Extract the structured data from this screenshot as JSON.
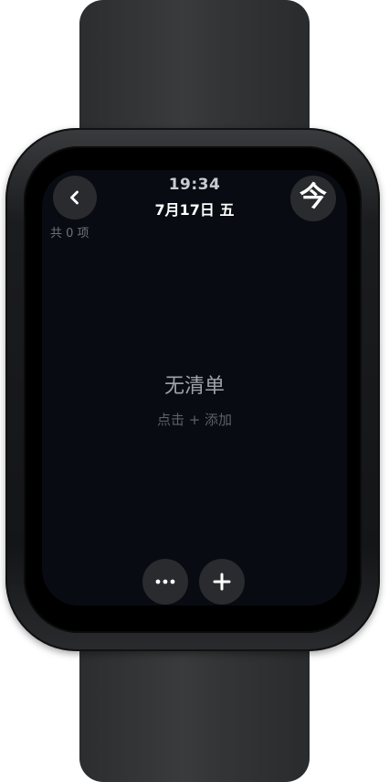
{
  "status": {
    "time": "19:34",
    "date": "7月17日 五"
  },
  "header": {
    "back_icon": "chevron-left-icon",
    "today_label": "今",
    "count_text": "共 0 项"
  },
  "empty_state": {
    "title": "无清单",
    "hint": "点击 + 添加"
  },
  "bottom_bar": {
    "more_icon": "more-horizontal-icon",
    "add_icon": "plus-icon"
  }
}
